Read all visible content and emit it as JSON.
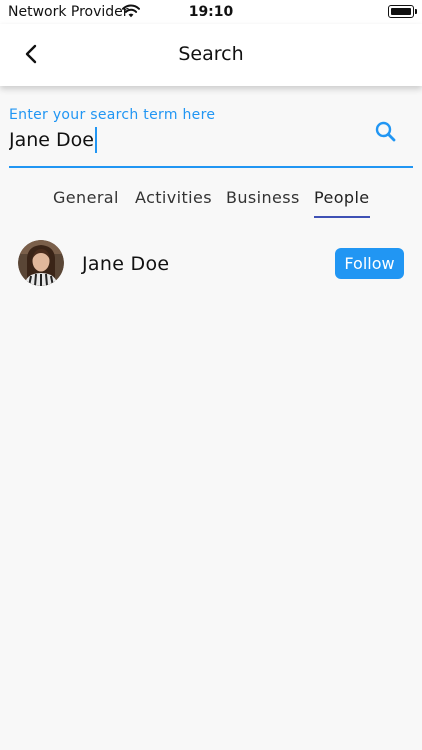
{
  "status_bar": {
    "carrier": "Network Provider",
    "time": "19:10",
    "wifi_icon": "wifi-icon",
    "battery_icon": "battery-full-icon"
  },
  "header": {
    "title": "Search",
    "back_icon": "chevron-left-icon"
  },
  "search": {
    "label": "Enter your search term here",
    "value": "Jane Doe",
    "search_icon": "search-icon"
  },
  "tabs": [
    {
      "label": "General",
      "active": false
    },
    {
      "label": "Activities",
      "active": false
    },
    {
      "label": "Business",
      "active": false
    },
    {
      "label": "People",
      "active": true
    }
  ],
  "results": [
    {
      "name": "Jane Doe",
      "action_label": "Follow"
    }
  ],
  "colors": {
    "accent": "#2196f3",
    "tab_indicator": "#3f51b5",
    "background": "#f8f8f8"
  }
}
